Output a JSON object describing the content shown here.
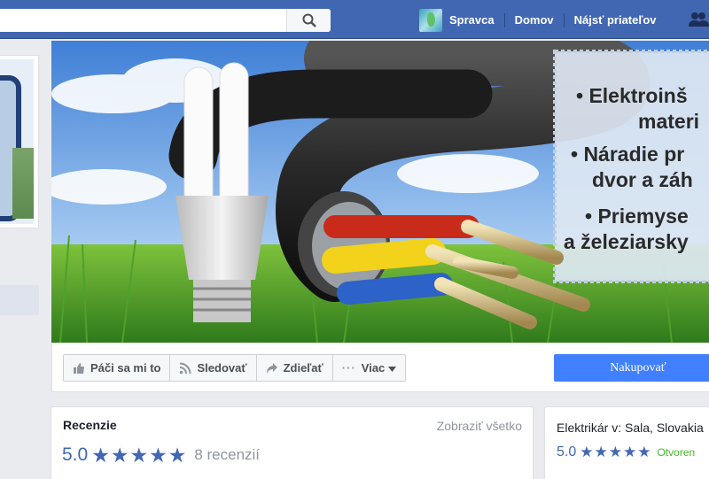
{
  "topbar": {
    "search_placeholder": "",
    "user_name": "Spravca",
    "nav_home": "Domov",
    "nav_find_friends": "Nájsť priateľov"
  },
  "cover": {
    "bullets": [
      "• Elektroinš",
      "materi",
      "• Náradie pr",
      "dvor a záh",
      "• Priemyse",
      "a železiarsky"
    ]
  },
  "actions": {
    "like": "Páči sa mi to",
    "follow": "Sledovať",
    "share": "Zdieľať",
    "more": "Viac",
    "shop": "Nakupovať"
  },
  "reviews": {
    "title": "Recenzie",
    "see_all": "Zobraziť všetko",
    "score": "5.0",
    "count": "8 recenzií",
    "stars": 5
  },
  "info": {
    "title": "Elektrikár v: Sala, Slovakia",
    "score": "5.0",
    "status": "Otvoren"
  },
  "colors": {
    "topbar": "#4267b2",
    "accent": "#4080ff",
    "star": "#4267b2",
    "open": "#42b72a"
  }
}
